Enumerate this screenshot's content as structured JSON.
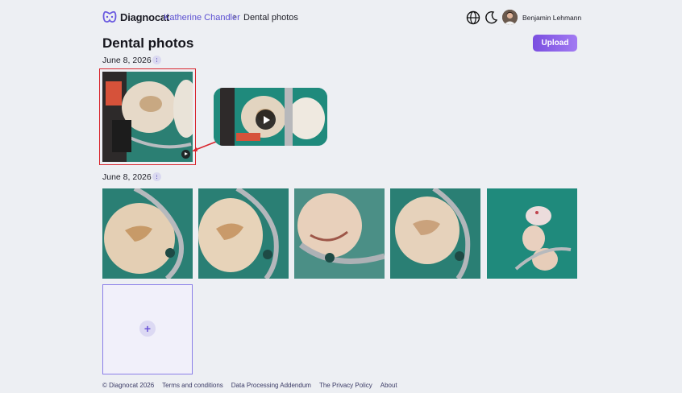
{
  "app": {
    "brand": "Diagnocat"
  },
  "breadcrumb": {
    "patient": "Katherine Chandler",
    "separator": "›",
    "current": "Dental photos"
  },
  "header": {
    "user_name": "Benjamin Lehmann",
    "icons": [
      "globe-icon",
      "moon-icon"
    ]
  },
  "page": {
    "title": "Dental photos",
    "upload_label": "Upload"
  },
  "groups": [
    {
      "date": "June 8, 2026",
      "items": [
        {
          "type": "video",
          "selected": true
        }
      ]
    },
    {
      "date": "June 8, 2026",
      "items": [
        {
          "type": "photo"
        },
        {
          "type": "photo"
        },
        {
          "type": "photo"
        },
        {
          "type": "photo"
        },
        {
          "type": "photo"
        }
      ]
    }
  ],
  "add_tile": {
    "icon": "plus-icon",
    "label": "+"
  },
  "footer": {
    "copyright": "© Diagnocat 2026",
    "links": [
      "Terms and conditions",
      "Data Processing Addendum",
      "The Privacy Policy",
      "About"
    ]
  },
  "colors": {
    "accent": "#7a4ee0",
    "link": "#5b4fd1",
    "highlight": "#d9262e",
    "background": "#edeff3"
  }
}
